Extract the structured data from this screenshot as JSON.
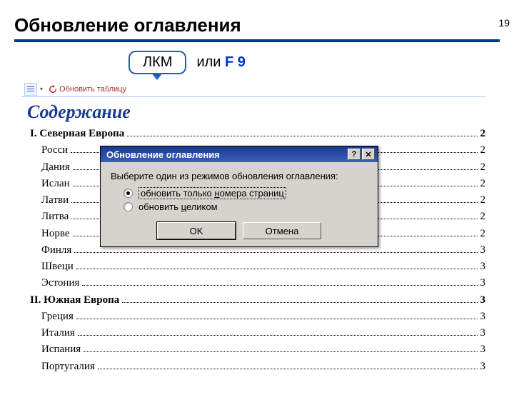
{
  "page_number": "19",
  "slide_title": "Обновление оглавления",
  "hint": {
    "callout": "ЛКМ",
    "or_text": "или ",
    "key": "F 9"
  },
  "toolbar": {
    "update_label": "Обновить таблицу"
  },
  "toc": {
    "title": "Содержание",
    "entries": [
      {
        "text": "I.  Северная Европа",
        "page": "2",
        "section": true
      },
      {
        "text": "Росси",
        "page": "2"
      },
      {
        "text": "Дания",
        "page": "2"
      },
      {
        "text": "Ислан",
        "page": "2"
      },
      {
        "text": "Латви",
        "page": "2"
      },
      {
        "text": "Литва",
        "page": "2"
      },
      {
        "text": "Норве",
        "page": "2"
      },
      {
        "text": "Финля",
        "page": "3"
      },
      {
        "text": "Швеци",
        "page": "3"
      },
      {
        "text": "Эстония",
        "page": "3"
      },
      {
        "text": "II.  Южная Европа",
        "page": "3",
        "section": true
      },
      {
        "text": "Греция",
        "page": "3"
      },
      {
        "text": "Италия",
        "page": "3"
      },
      {
        "text": "Испания",
        "page": "3"
      },
      {
        "text": "Португалия",
        "page": "3"
      }
    ]
  },
  "dialog": {
    "title": "Обновление оглавления",
    "instruction": "Выберите один из режимов обновления оглавления:",
    "options": {
      "opt1_prefix": "обновить только ",
      "opt1_access": "н",
      "opt1_suffix": "омера страниц",
      "opt2_prefix": "обновить ",
      "opt2_access": "ц",
      "opt2_suffix": "еликом"
    },
    "ok_label": "OK",
    "cancel_label": "Отмена",
    "help_symbol": "?",
    "close_symbol": "✕"
  }
}
